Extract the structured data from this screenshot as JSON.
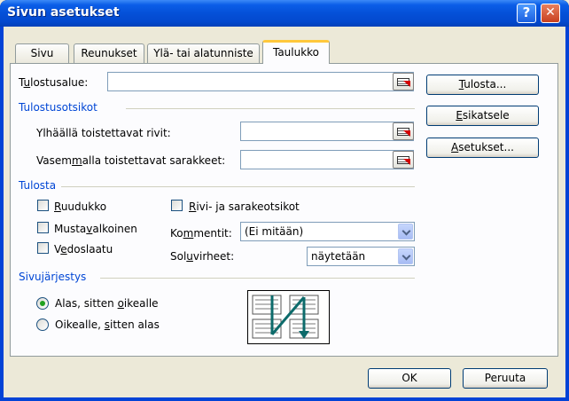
{
  "window": {
    "title": "Sivun asetukset",
    "help_glyph": "?",
    "close_glyph": "✕"
  },
  "tabs": [
    {
      "label": "Sivu",
      "active": false
    },
    {
      "label": "Reunukset",
      "active": false
    },
    {
      "label": "Ylä- tai alatunniste",
      "active": false
    },
    {
      "label": "Taulukko",
      "active": true
    }
  ],
  "print_area": {
    "label_pre": "T",
    "label_ul": "u",
    "label_post": "lostusalue:",
    "value": ""
  },
  "titles_group": {
    "title": "Tulostusotsikot",
    "rows_label": "Ylhäällä toistettavat rivit:",
    "rows_value": "",
    "cols_label_pre": "Vasem",
    "cols_label_ul": "m",
    "cols_label_post": "alla toistettavat sarakkeet:",
    "cols_value": ""
  },
  "print_group": {
    "title": "Tulosta",
    "gridlines": {
      "pre": "",
      "ul": "R",
      "post": "uudukko",
      "checked": false
    },
    "blackwhite": {
      "pre": "Musta",
      "ul": "v",
      "post": "alkoinen",
      "checked": false
    },
    "draft": {
      "pre": "V",
      "ul": "e",
      "post": "doslaatu",
      "checked": false
    },
    "headings": {
      "pre": "",
      "ul": "R",
      "post": "ivi- ja sarakeotsikot",
      "checked": false
    },
    "comments_label_pre": "Ko",
    "comments_label_ul": "m",
    "comments_label_post": "mentit:",
    "comments_value": "(Ei mitään)",
    "errors_label_pre": "Sol",
    "errors_label_ul": "u",
    "errors_label_post": "virheet:",
    "errors_value": "näytetään"
  },
  "order_group": {
    "title": "Sivujärjestys",
    "down_then_over": {
      "pre": "Alas, sitten ",
      "ul": "o",
      "post": "ikealle",
      "selected": true
    },
    "over_then_down": {
      "pre": "Oikealle, ",
      "ul": "s",
      "post": "itten alas",
      "selected": false
    }
  },
  "side_buttons": {
    "print": {
      "ul": "T",
      "post": "ulosta..."
    },
    "preview": {
      "ul": "E",
      "post": "sikatsele"
    },
    "options": {
      "ul": "A",
      "post": "setukset..."
    }
  },
  "footer": {
    "ok": "OK",
    "cancel": "Peruuta"
  },
  "colors": {
    "accent": "#0046d5",
    "title_bar": "#0450d8",
    "tab_highlight": "#ffc83c",
    "radio_dot": "#21a121"
  }
}
